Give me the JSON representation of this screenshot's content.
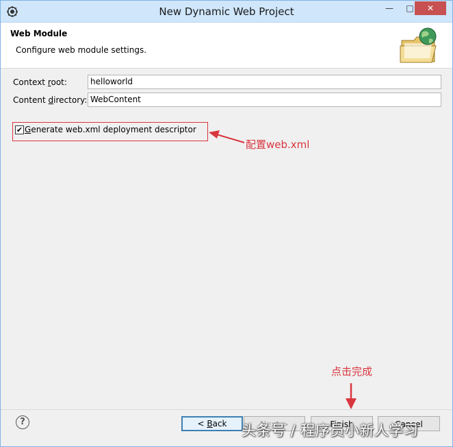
{
  "window": {
    "title": "New Dynamic Web Project",
    "controls": {
      "minimize": "—",
      "maximize": "□",
      "close": "✕"
    }
  },
  "header": {
    "title": "Web Module",
    "description": "Configure web module settings.",
    "icon": "folder-globe-icon"
  },
  "form": {
    "context_root": {
      "label_pre": "Context ",
      "label_mnemonic": "r",
      "label_post": "oot:",
      "value": "helloworld"
    },
    "content_directory": {
      "label_pre": "Content ",
      "label_mnemonic": "d",
      "label_post": "irectory:",
      "value": "WebContent"
    },
    "generate_xml": {
      "checked": true,
      "label_mnemonic": "G",
      "label_post": "enerate web.xml deployment descriptor"
    }
  },
  "annotations": {
    "configure_xml": "配置web.xml",
    "click_finish": "点击完成",
    "color": "#d9363e"
  },
  "footer": {
    "help_icon": "help-icon",
    "back": {
      "prefix": "< ",
      "mnemonic": "B",
      "rest": "ack"
    },
    "next": "Next >",
    "finish": "Finish",
    "cancel": "Cancel"
  },
  "watermark": "头条号 / 程序员小新人学习"
}
